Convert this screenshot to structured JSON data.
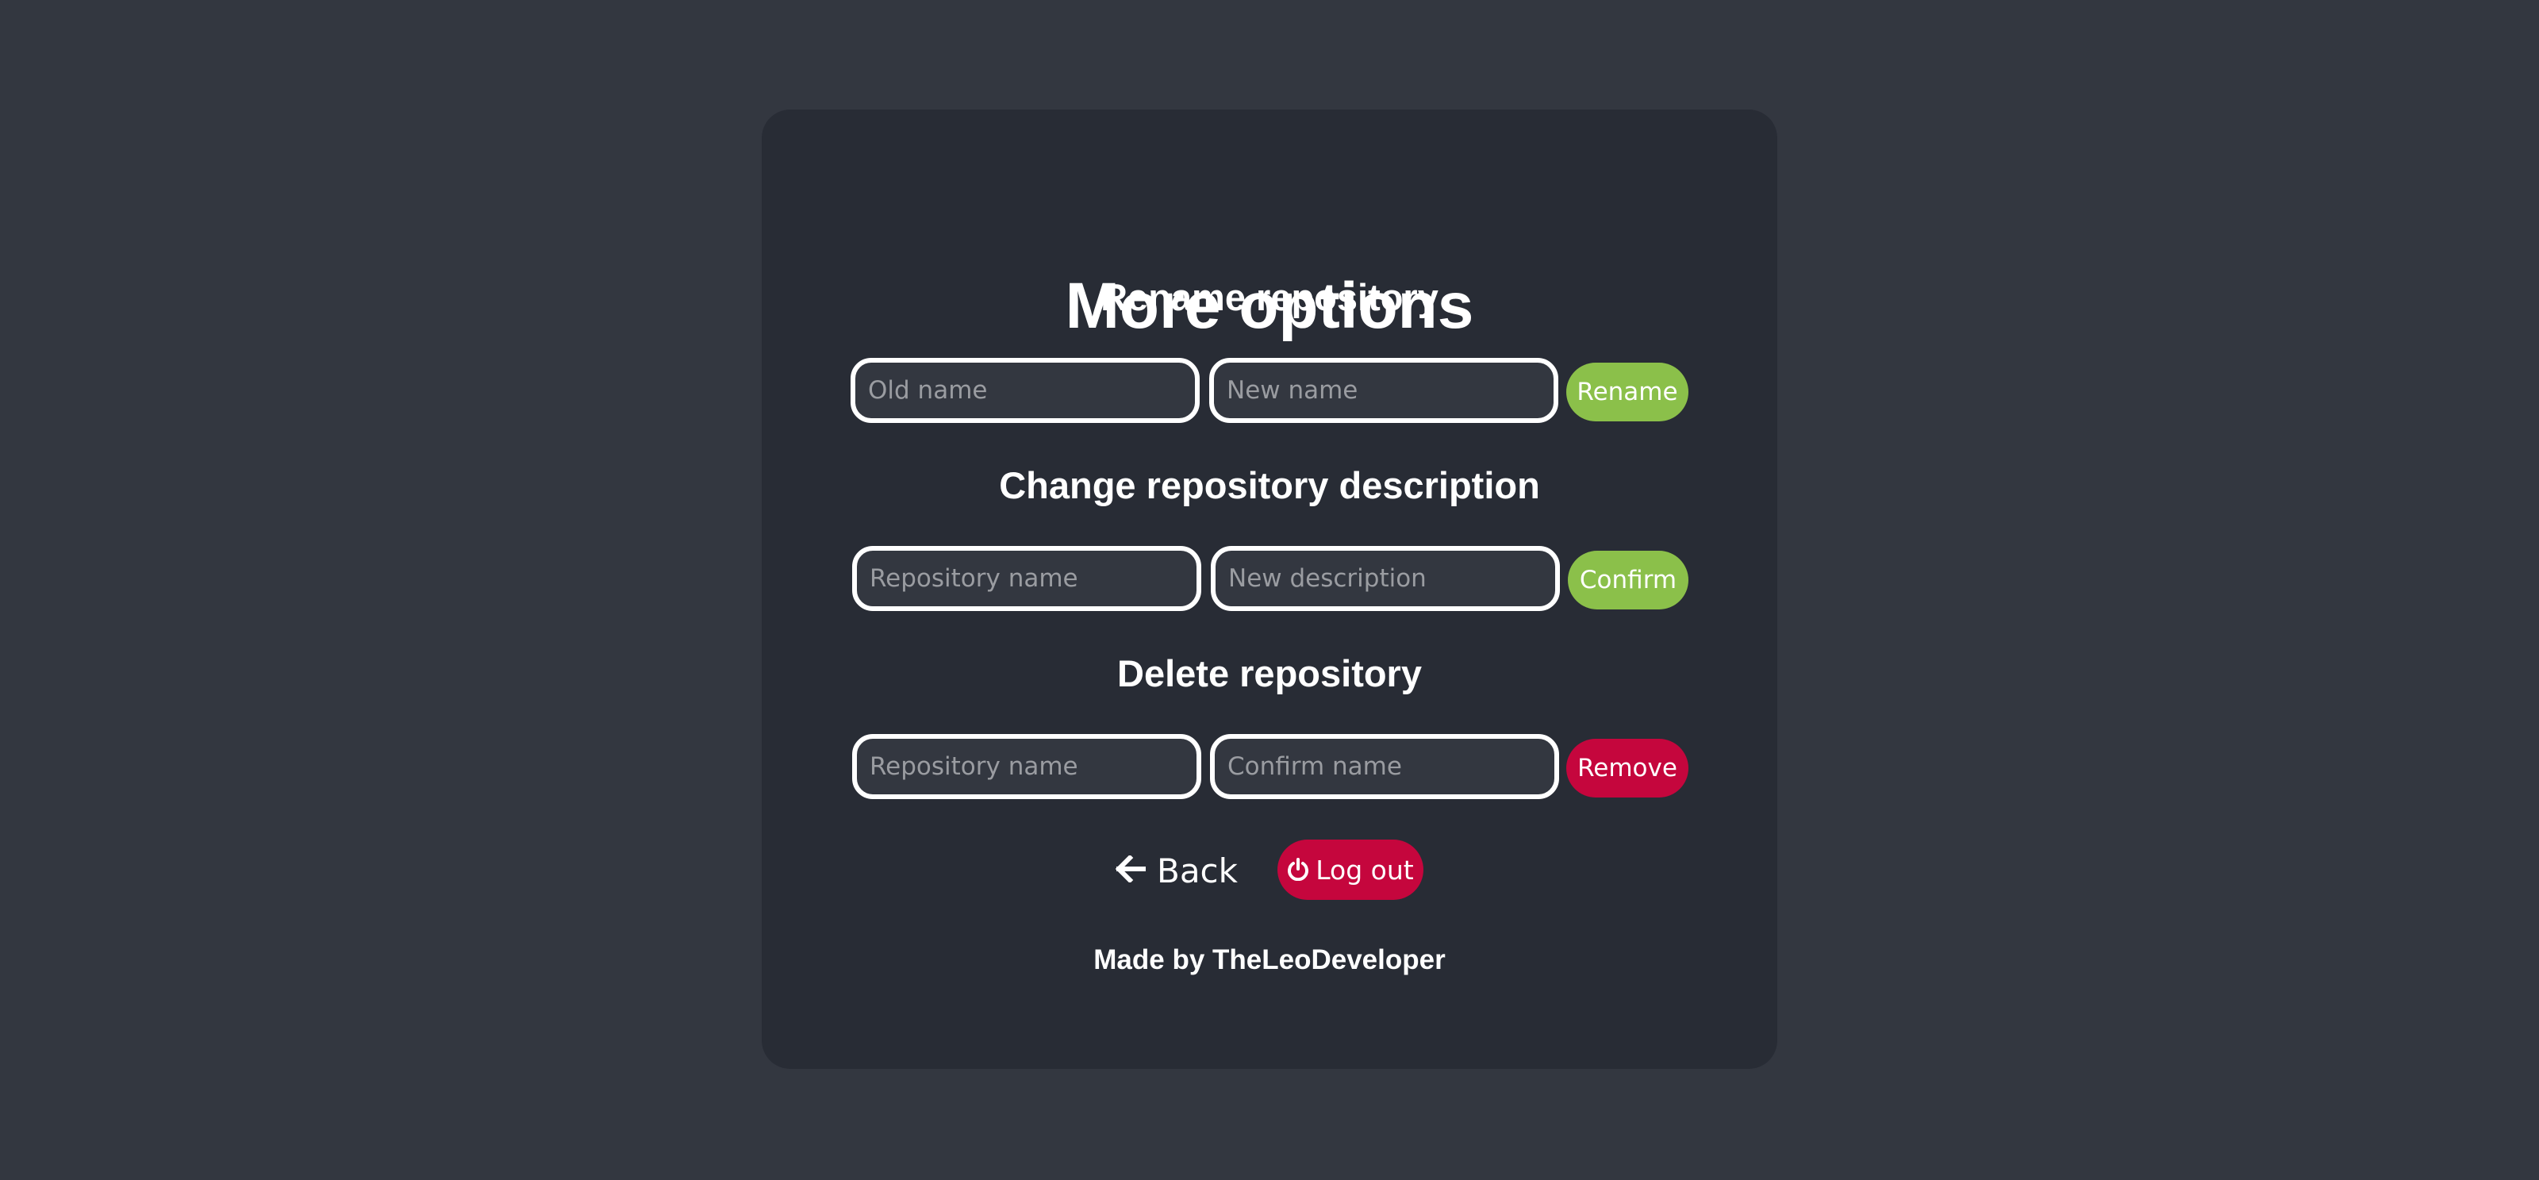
{
  "page": {
    "title": "More options"
  },
  "sections": [
    {
      "title": "Rename repository",
      "inputs": [
        {
          "placeholder": "Old name",
          "value": ""
        },
        {
          "placeholder": "New name",
          "value": ""
        }
      ],
      "button": {
        "label": "Rename",
        "color": "#8bc04a"
      }
    },
    {
      "title": "Change repository description",
      "inputs": [
        {
          "placeholder": "Repository name",
          "value": ""
        },
        {
          "placeholder": "New description",
          "value": ""
        }
      ],
      "button": {
        "label": "Confirm",
        "color": "#8bc04a"
      }
    },
    {
      "title": "Delete repository",
      "inputs": [
        {
          "placeholder": "Repository name",
          "value": ""
        },
        {
          "placeholder": "Confirm name",
          "value": ""
        }
      ],
      "button": {
        "label": "Remove",
        "color": "#c5063d"
      }
    }
  ],
  "nav": {
    "back_label": "Back",
    "back_icon": "arrow-left-icon",
    "logout_label": "Log out",
    "logout_icon": "power-icon"
  },
  "footer": {
    "text": "Made by TheLeoDeveloper"
  },
  "colors": {
    "background": "#333740",
    "card": "#282c35",
    "accent_green": "#8bc04a",
    "accent_red": "#c5063d"
  }
}
